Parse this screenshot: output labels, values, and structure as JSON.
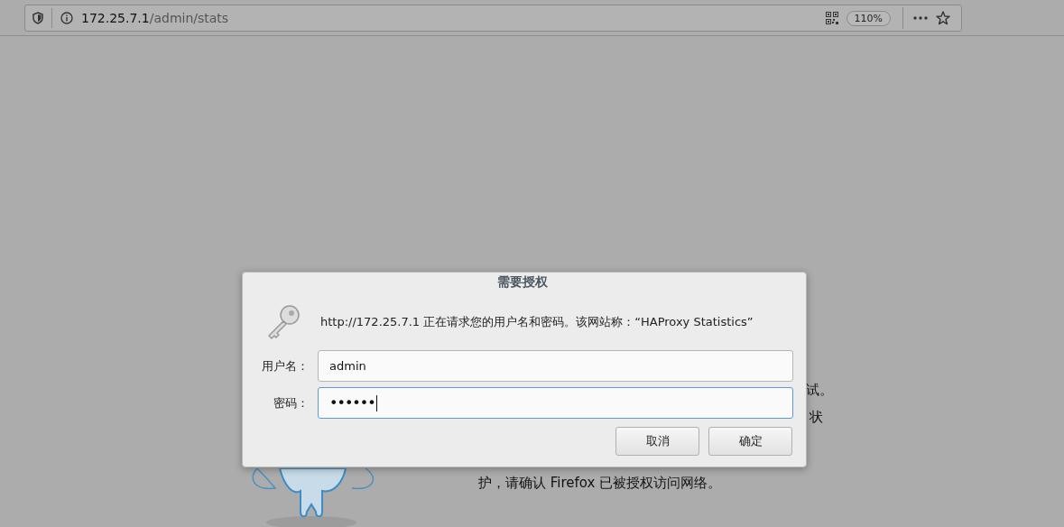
{
  "address_bar": {
    "host": "172.25.7.1",
    "path": "/admin/stats",
    "zoom": "110%"
  },
  "background_page": {
    "fragments": [
      "试。",
      "状",
      "护，请确认 Firefox 已被授权访问网络。"
    ]
  },
  "dialog": {
    "title": "需要授权",
    "message": "http://172.25.7.1 正在请求您的用户名和密码。该网站称：“HAProxy Statistics”",
    "fields": [
      {
        "label": "用户名：",
        "value": "admin",
        "kind": "text",
        "focused": false
      },
      {
        "label": "密码：",
        "value": "••••••",
        "kind": "password",
        "focused": true
      }
    ],
    "buttons": [
      "取消",
      "确定"
    ]
  }
}
